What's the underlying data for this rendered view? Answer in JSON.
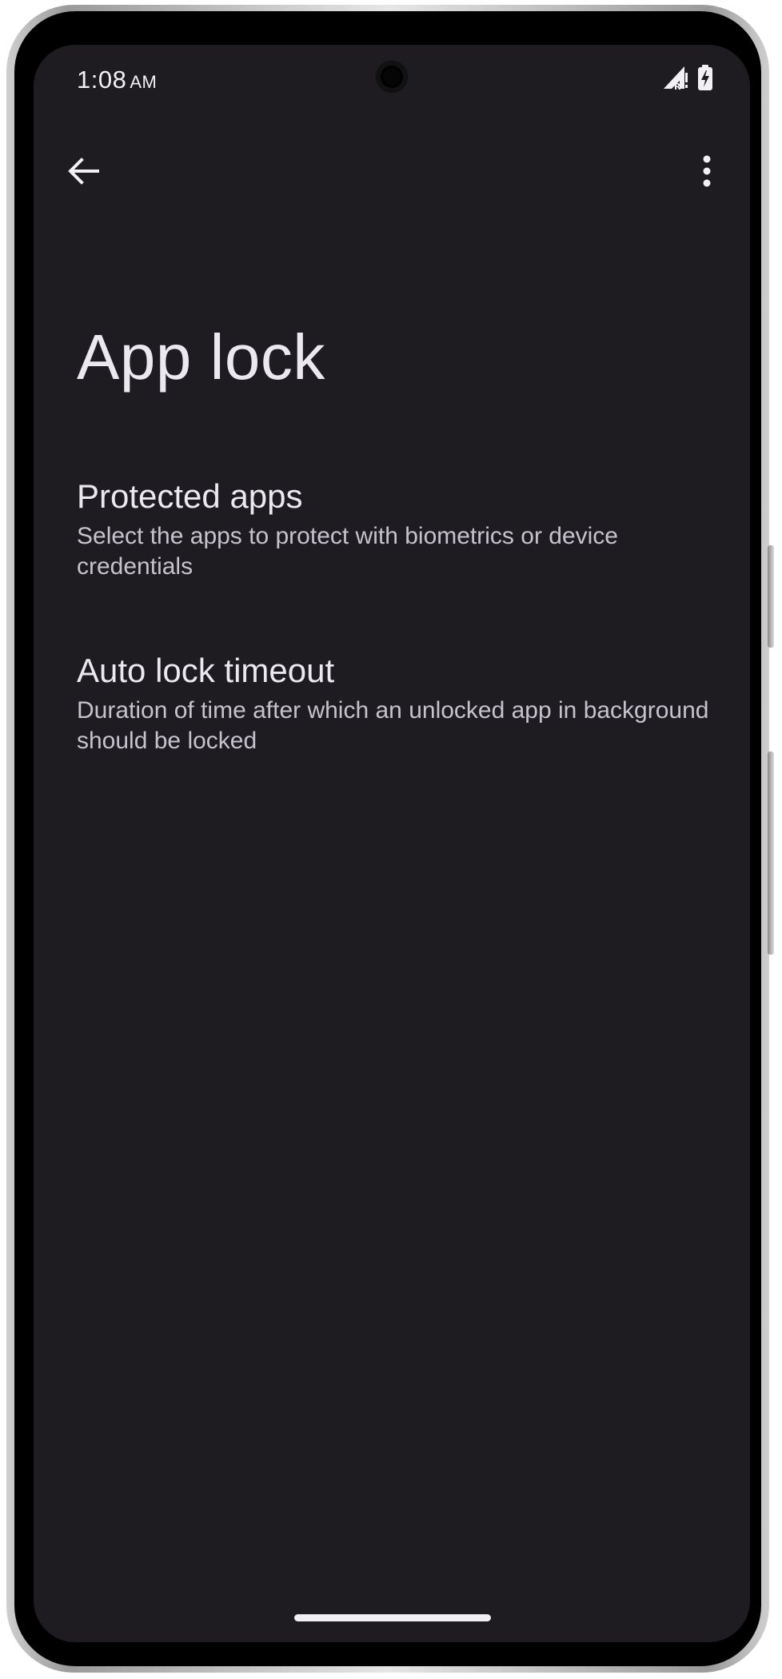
{
  "status_bar": {
    "time": "1:08",
    "ampm": "AM",
    "icons": [
      "signal-roaming-icon",
      "battery-charging-icon"
    ]
  },
  "top_bar": {
    "back_icon": "arrow-back-icon",
    "more_icon": "more-vertical-icon"
  },
  "page": {
    "title": "App lock"
  },
  "preferences": [
    {
      "title": "Protected apps",
      "summary": "Select the apps to protect with biometrics or device credentials"
    },
    {
      "title": "Auto lock timeout",
      "summary": "Duration of time after which an unlocked app in background should be locked"
    }
  ],
  "colors": {
    "background": "#1e1c21",
    "primary_text": "#ece8ef",
    "secondary_text": "#c7c2cc"
  }
}
